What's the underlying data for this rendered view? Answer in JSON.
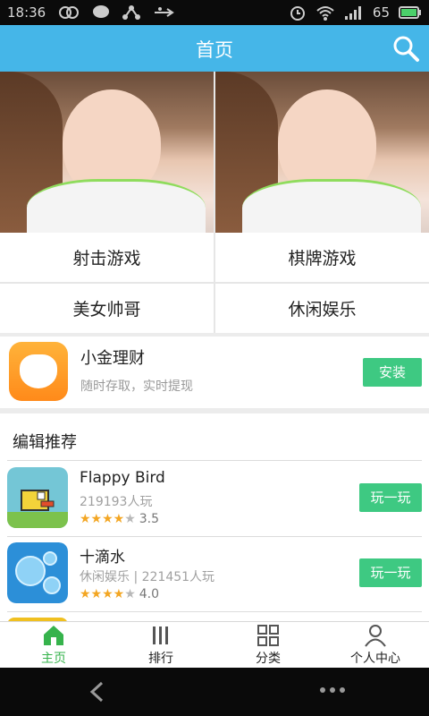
{
  "status": {
    "time": "18:36",
    "battery": "65"
  },
  "header": {
    "title": "首页"
  },
  "categories": [
    "射击游戏",
    "棋牌游戏",
    "美女帅哥",
    "休闲娱乐"
  ],
  "ad": {
    "name": "小金理财",
    "subtitle": "随时存取，实时提现",
    "button": "安装"
  },
  "recommend": {
    "title": "编辑推荐",
    "items": [
      {
        "name": "Flappy Bird",
        "meta": "219193人玩",
        "rating": 3.5,
        "stars_full": "★★★★",
        "stars_empty": "★",
        "score": "3.5",
        "button": "玩一玩"
      },
      {
        "name": "十滴水",
        "meta": "休闲娱乐 | 221451人玩",
        "rating": 4.0,
        "stars_full": "★★★★",
        "stars_empty": "★",
        "score": "4.0",
        "button": "玩一玩"
      }
    ]
  },
  "tabs": [
    {
      "label": "主页",
      "icon": "home-icon",
      "active": true
    },
    {
      "label": "排行",
      "icon": "bars-icon",
      "active": false
    },
    {
      "label": "分类",
      "icon": "grid-icon",
      "active": false
    },
    {
      "label": "个人中心",
      "icon": "person-icon",
      "active": false
    }
  ],
  "colors": {
    "header": "#45b6e8",
    "accent": "#36b34c",
    "button": "#3ec982"
  }
}
